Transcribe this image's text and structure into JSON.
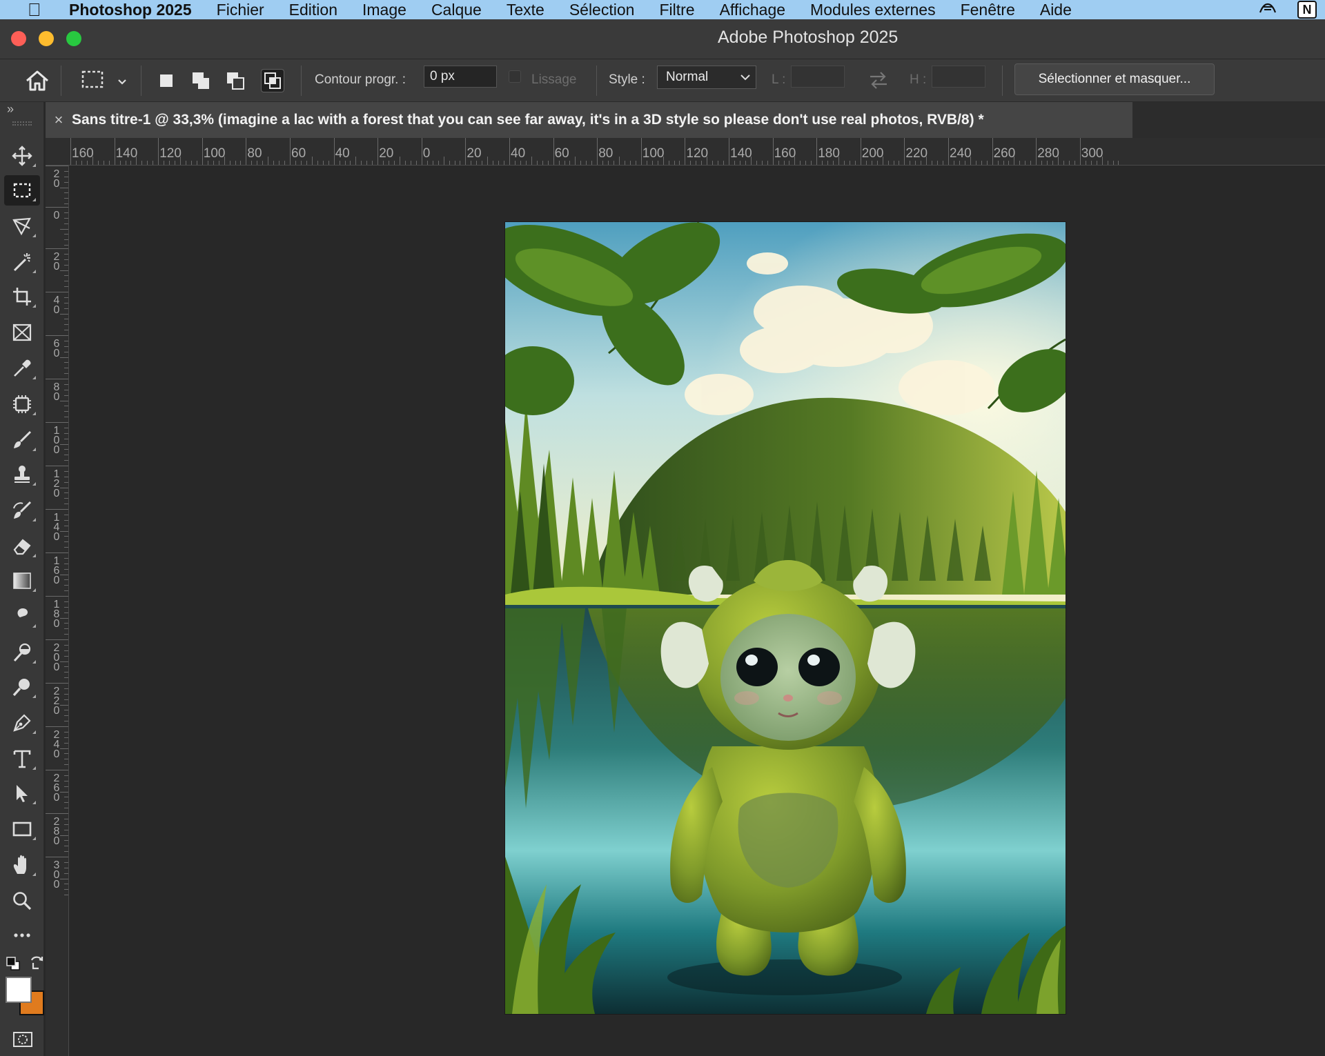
{
  "menubar": {
    "apple_icon": "apple-icon",
    "app_name": "Photoshop 2025",
    "items": [
      "Fichier",
      "Edition",
      "Image",
      "Calque",
      "Texte",
      "Sélection",
      "Filtre",
      "Affichage",
      "Modules externes",
      "Fenêtre",
      "Aide"
    ],
    "notion_letter": "N"
  },
  "window": {
    "title": "Adobe Photoshop 2025"
  },
  "options_bar": {
    "feather_label": "Contour progr. :",
    "feather_value": "0 px",
    "antialias_label": "Lissage",
    "style_label": "Style :",
    "style_value": "Normal",
    "width_label": "L :",
    "height_label": "H :",
    "select_mask_label": "Sélectionner et masquer..."
  },
  "document": {
    "tab_title": "Sans titre-1 @ 33,3% (imagine a lac with a forest that you can see far away, it's in a 3D style so please don't use real photos, RVB/8) *"
  },
  "rulers": {
    "horizontal": [
      "160",
      "140",
      "120",
      "100",
      "80",
      "60",
      "40",
      "20",
      "0",
      "20",
      "40",
      "60",
      "80",
      "100",
      "120",
      "140",
      "160",
      "180",
      "200",
      "220",
      "240",
      "260",
      "280",
      "300"
    ],
    "vertical": [
      "20",
      "0",
      "20",
      "40",
      "60",
      "80",
      "100",
      "120",
      "140",
      "160",
      "180",
      "200",
      "220",
      "240",
      "260",
      "280",
      "300"
    ]
  },
  "toolbar": {
    "tools": [
      "move-tool",
      "rectangular-marquee-tool",
      "lasso-tool",
      "magic-wand-tool",
      "crop-tool",
      "frame-tool",
      "eyedropper-tool",
      "spot-healing-tool",
      "brush-tool",
      "clone-stamp-tool",
      "history-brush-tool",
      "eraser-tool",
      "gradient-tool",
      "blur-tool",
      "dodge-tool",
      "zoom-tool",
      "pen-tool",
      "type-tool",
      "path-selection-tool",
      "rectangle-tool",
      "hand-tool",
      "zoom-tool-2",
      "more-tools"
    ],
    "foreground_color": "#ffffff",
    "background_color": "#e07b1e"
  },
  "colors": {
    "menubar_bg": "#9fcdf2",
    "panel_bg": "#3a3a3a",
    "canvas_bg": "#282828"
  }
}
